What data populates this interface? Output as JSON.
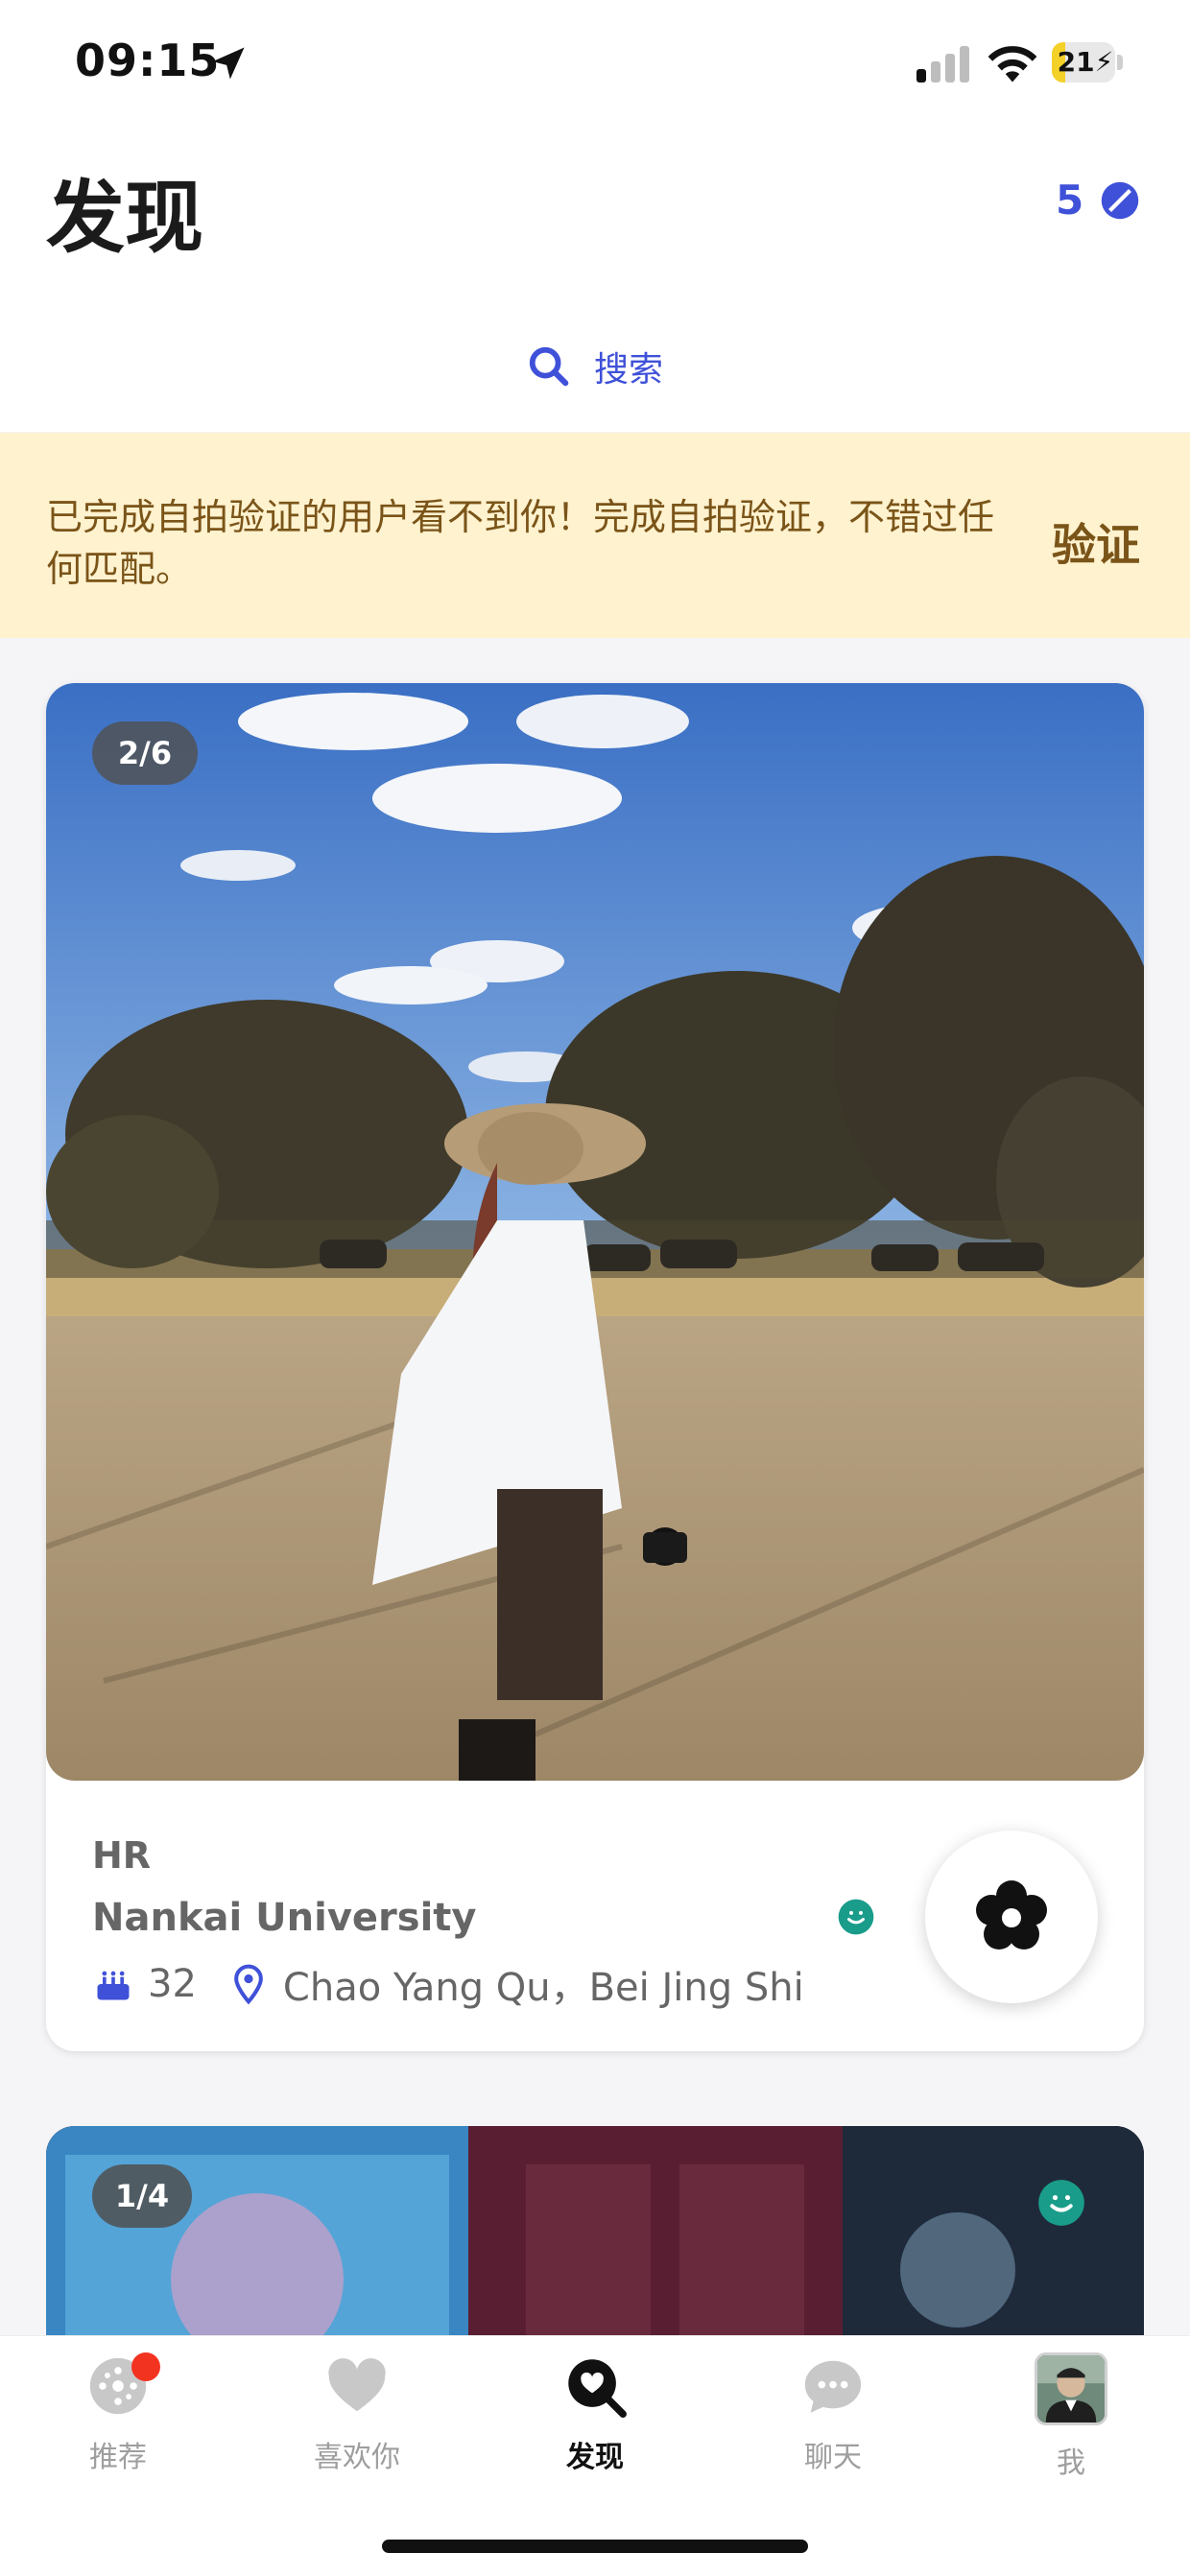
{
  "status_bar": {
    "time": "09:15",
    "battery": "21",
    "battery_level": 0.21,
    "icons": [
      "location-arrow-icon",
      "cellular-signal-icon",
      "wifi-icon",
      "battery-charging-icon"
    ]
  },
  "header": {
    "title": "发现",
    "credits": "5",
    "credits_icon": "pill-icon",
    "search_label": "搜索"
  },
  "banner": {
    "text": "已完成自拍验证的用户看不到你！完成自拍验证，不错过任何匹配。",
    "action": "验证"
  },
  "profile_card": {
    "photo_counter": "2/6",
    "job": "HR",
    "school": "Nankai University",
    "age": "32",
    "location": "Chao Yang Qu，Bei Jing Shi",
    "verified_icon": "face-verified-icon",
    "action_icon": "flower-icon"
  },
  "profile_card_2": {
    "photo_counter": "1/4"
  },
  "tabbar": {
    "tabs": [
      {
        "label": "推荐",
        "icon": "explore-icon",
        "badge": true
      },
      {
        "label": "喜欢你",
        "icon": "heart-icon"
      },
      {
        "label": "发现",
        "icon": "discover-heart-search-icon",
        "active": true
      },
      {
        "label": "聊天",
        "icon": "chat-bubble-icon"
      },
      {
        "label": "我",
        "icon": "avatar"
      }
    ]
  },
  "colors": {
    "accent": "#3f51d8",
    "banner_bg": "#fff2cf",
    "banner_text": "#7a5418",
    "badge_red": "#f2331f",
    "verified_teal": "#1a9c8a"
  }
}
